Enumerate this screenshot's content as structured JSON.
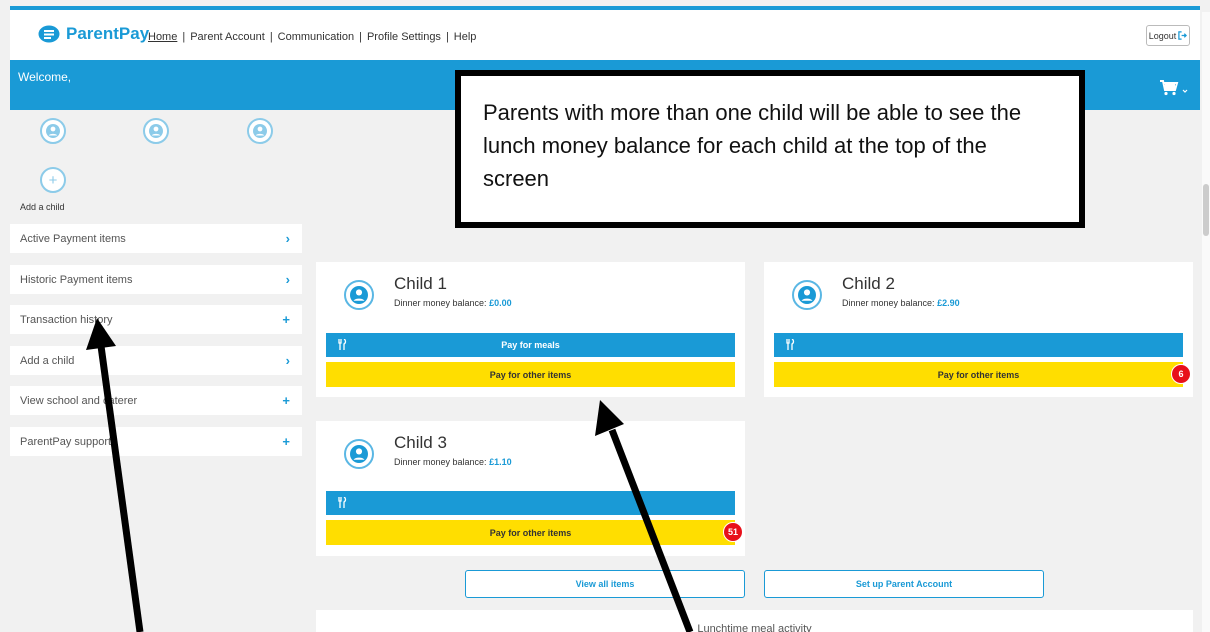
{
  "header": {
    "logo_text": "ParentPay",
    "nav": [
      "Home",
      "Parent Account",
      "Communication",
      "Profile Settings",
      "Help"
    ],
    "nav_sep": "|",
    "logout_label": "Logout"
  },
  "banner": {
    "welcome": "Welcome,"
  },
  "sidebar": {
    "add_child_label": "Add a child",
    "items": [
      {
        "label": "Active Payment items",
        "icon": "chevron-right-icon"
      },
      {
        "label": "Historic Payment items",
        "icon": "chevron-right-icon"
      },
      {
        "label": "Transaction history",
        "icon": "plus-icon"
      },
      {
        "label": "Add a child",
        "icon": "chevron-right-icon"
      },
      {
        "label": "View school and caterer",
        "icon": "plus-icon"
      },
      {
        "label": "ParentPay support",
        "icon": "plus-icon"
      }
    ]
  },
  "children": [
    {
      "name": "Child 1",
      "balance_label": "Dinner money balance:",
      "balance": "£0.00",
      "meals_label": "Pay for meals",
      "other_label": "Pay for other items",
      "badge": ""
    },
    {
      "name": "Child 2",
      "balance_label": "Dinner money balance:",
      "balance": "£2.90",
      "meals_label": "",
      "other_label": "Pay for other items",
      "badge": "6"
    },
    {
      "name": "Child 3",
      "balance_label": "Dinner money balance:",
      "balance": "£1.10",
      "meals_label": "",
      "other_label": "Pay for other items",
      "badge": "51"
    }
  ],
  "actions": {
    "view_all": "View all items",
    "setup_account": "Set up Parent Account"
  },
  "activity": {
    "title": "Lunchtime meal activity"
  },
  "callout": {
    "text": "Parents with more than one child will be able to see the lunch money balance for each child at the top of the screen"
  },
  "colors": {
    "brand_blue": "#1a9ad6",
    "yellow": "#ffde00",
    "badge_red": "#e8101a"
  }
}
